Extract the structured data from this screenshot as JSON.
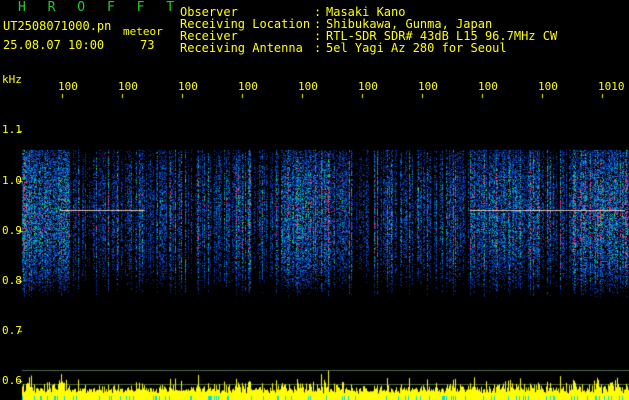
{
  "header": {
    "title": "H R O F F T",
    "file_name": "UT2508071000.pn",
    "mode_label": "meteor",
    "date_time": "25.08.07 10:00",
    "meteor_count": "73"
  },
  "info": [
    {
      "label": "Observer",
      "value": "Masaki Kano"
    },
    {
      "label": "Receiving Location",
      "value": "Shibukawa, Gunma, Japan"
    },
    {
      "label": "Receiver",
      "value": "RTL-SDR SDR# 43dB L15 96.7MHz CW"
    },
    {
      "label": "Receiving Antenna",
      "value": "5el Yagi Az 280 for Seoul"
    }
  ],
  "axis": {
    "y_unit": "kHz",
    "y_ticks": [
      "1.1",
      "1.0",
      "0.9",
      "0.8",
      "0.7",
      "0.6"
    ],
    "x_ticks": [
      "100",
      "100",
      "100",
      "100",
      "100",
      "100",
      "100",
      "100",
      "100",
      "1010"
    ]
  },
  "colors": {
    "background": "#000000",
    "text": "#ffff00",
    "title": "#22cc22",
    "signal_band": "#ffffff"
  }
}
